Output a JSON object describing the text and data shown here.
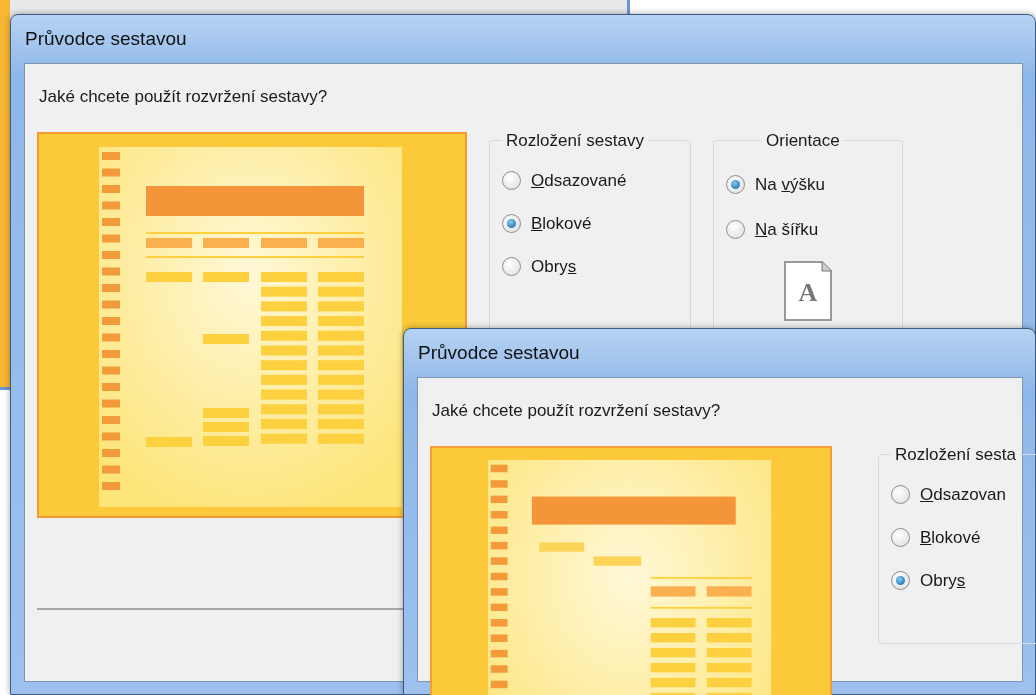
{
  "windows": [
    {
      "title": "Průvodce sestavou",
      "question": "Jaké chcete použít rozvržení sestavy?",
      "layout_group": {
        "title": "Rozložení sestavy",
        "options": [
          {
            "selected": false,
            "parts": [
              {
                "text": "O",
                "underline": true
              },
              {
                "text": "dsazované",
                "underline": false
              }
            ]
          },
          {
            "selected": true,
            "parts": [
              {
                "text": "B",
                "underline": true
              },
              {
                "text": "lokové",
                "underline": false
              }
            ]
          },
          {
            "selected": false,
            "parts": [
              {
                "text": "Obry",
                "underline": false
              },
              {
                "text": "s",
                "underline": true
              }
            ]
          }
        ]
      },
      "orientation_group": {
        "title": "Orientace",
        "page_letter": "A",
        "options": [
          {
            "selected": true,
            "parts": [
              {
                "text": "Na ",
                "underline": false
              },
              {
                "text": "v",
                "underline": true
              },
              {
                "text": "ýšku",
                "underline": false
              }
            ]
          },
          {
            "selected": false,
            "parts": [
              {
                "text": "N",
                "underline": true
              },
              {
                "text": "a šířku",
                "underline": false
              }
            ]
          }
        ]
      }
    },
    {
      "title": "Průvodce sestavou",
      "question": "Jaké chcete použít rozvržení sestavy?",
      "layout_group": {
        "title": "Rozložení sesta",
        "options": [
          {
            "selected": false,
            "parts": [
              {
                "text": "O",
                "underline": true
              },
              {
                "text": "dsazovan",
                "underline": false
              }
            ]
          },
          {
            "selected": false,
            "parts": [
              {
                "text": "B",
                "underline": true
              },
              {
                "text": "lokové",
                "underline": false
              }
            ]
          },
          {
            "selected": true,
            "parts": [
              {
                "text": "Obry",
                "underline": false
              },
              {
                "text": "s",
                "underline": true
              }
            ]
          }
        ]
      }
    }
  ]
}
